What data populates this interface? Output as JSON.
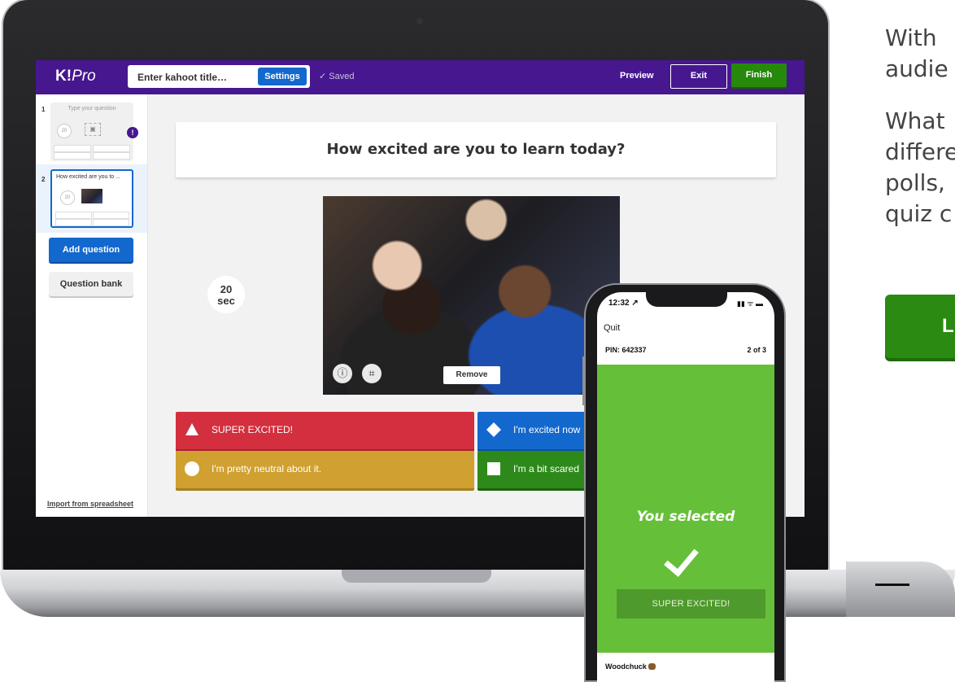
{
  "marketing": {
    "lines_1": [
      "With",
      "audie"
    ],
    "lines_2": [
      "What",
      "differe",
      "polls,",
      "quiz c"
    ],
    "cta_label": "L"
  },
  "editor": {
    "logo_bold": "K!",
    "logo_italic": "Pro",
    "title_placeholder": "Enter kahoot title…",
    "settings_label": "Settings",
    "saved_label": "✓ Saved",
    "preview_label": "Preview",
    "exit_label": "Exit",
    "finish_label": "Finish"
  },
  "sidebar": {
    "slides": [
      {
        "number": "1",
        "question": "Type your question",
        "timer": "20",
        "warning": "!"
      },
      {
        "number": "2",
        "question": "How excited are you to ...",
        "timer": "20"
      }
    ],
    "add_question_label": "Add question",
    "question_bank_label": "Question bank",
    "import_label": "Import from spreadsheet"
  },
  "question": {
    "text": "How excited are you to learn today?",
    "timer_value": "20",
    "timer_unit": "sec",
    "remove_label": "Remove",
    "answers": [
      {
        "label": "SUPER EXCITED!",
        "color": "#d32f3e",
        "shape": "triangle"
      },
      {
        "label": "I'm excited now",
        "color": "#1368ce",
        "shape": "diamond"
      },
      {
        "label": "I'm pretty neutral about it.",
        "color": "#d0a030",
        "shape": "circle"
      },
      {
        "label": "I'm a bit scared",
        "color": "#2d8a1a",
        "shape": "square"
      }
    ]
  },
  "phone": {
    "time": "12:32 ↗",
    "status_icons": "▮▮ ᯤ ▬",
    "quit_label": "Quit",
    "pin": "PIN: 642337",
    "progress": "2 of 3",
    "you_selected": "You selected",
    "selected_answer": "SUPER EXCITED!",
    "nickname": "Woodchuck",
    "accent": "#66bf39"
  }
}
